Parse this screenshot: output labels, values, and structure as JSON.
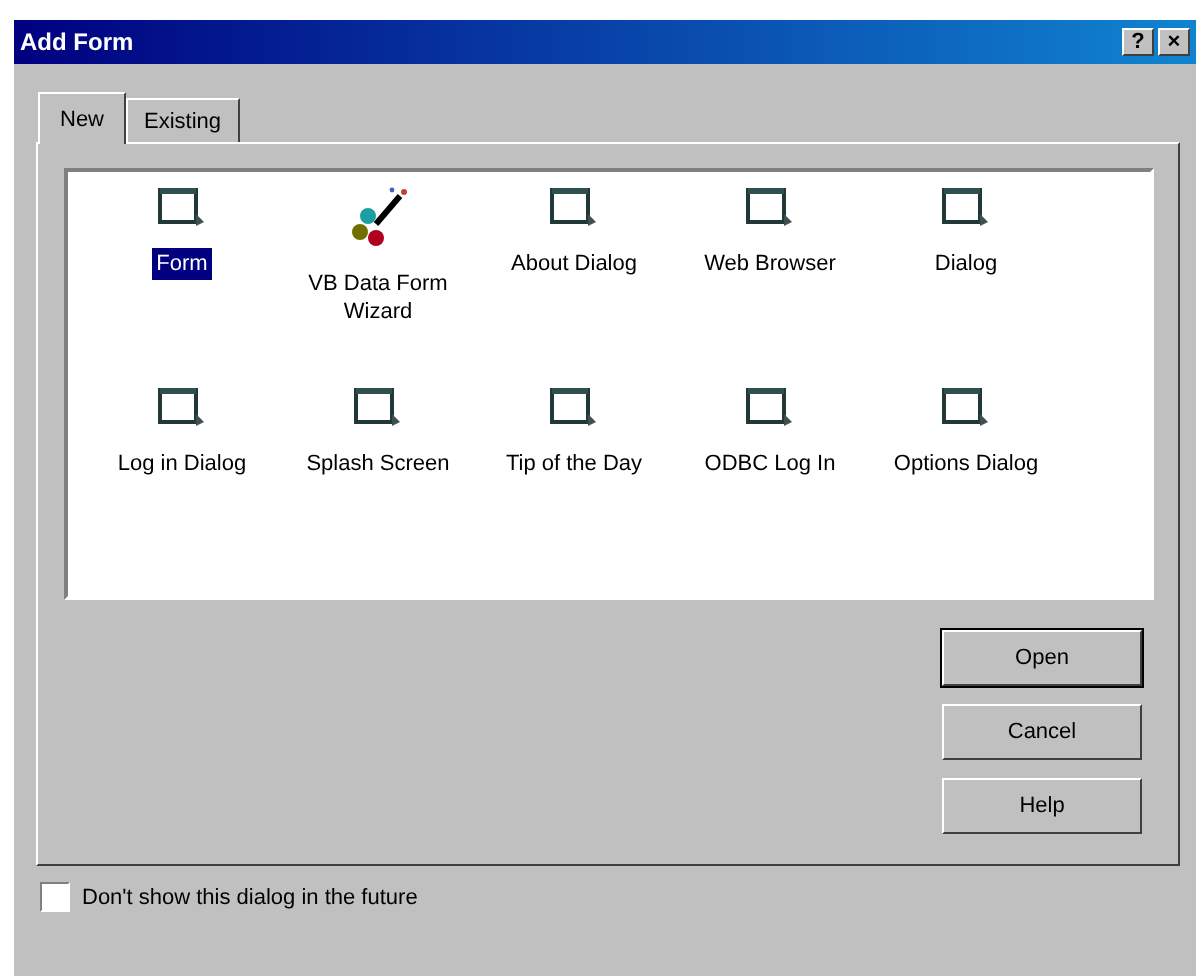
{
  "window": {
    "title": "Add Form",
    "buttons": [
      "?",
      "×"
    ]
  },
  "tabs": [
    {
      "label": "New",
      "selected": true
    },
    {
      "label": "Existing",
      "selected": false
    }
  ],
  "items": [
    {
      "label": "Form",
      "kind": "form",
      "selected": true
    },
    {
      "label": "VB Data Form Wizard",
      "kind": "wizard",
      "selected": false
    },
    {
      "label": "About Dialog",
      "kind": "form",
      "selected": false
    },
    {
      "label": "Web Browser",
      "kind": "form",
      "selected": false
    },
    {
      "label": "Dialog",
      "kind": "form",
      "selected": false
    },
    {
      "label": "Log in Dialog",
      "kind": "form",
      "selected": false
    },
    {
      "label": "Splash Screen",
      "kind": "form",
      "selected": false
    },
    {
      "label": "Tip of the Day",
      "kind": "form",
      "selected": false
    },
    {
      "label": "ODBC Log In",
      "kind": "form",
      "selected": false
    },
    {
      "label": "Options Dialog",
      "kind": "form",
      "selected": false
    }
  ],
  "buttons": [
    {
      "label": "Open",
      "default": true
    },
    {
      "label": "Cancel",
      "default": false
    },
    {
      "label": "Help",
      "default": false
    }
  ],
  "checkbox": {
    "label": "Don't show this dialog in the future",
    "checked": false
  }
}
